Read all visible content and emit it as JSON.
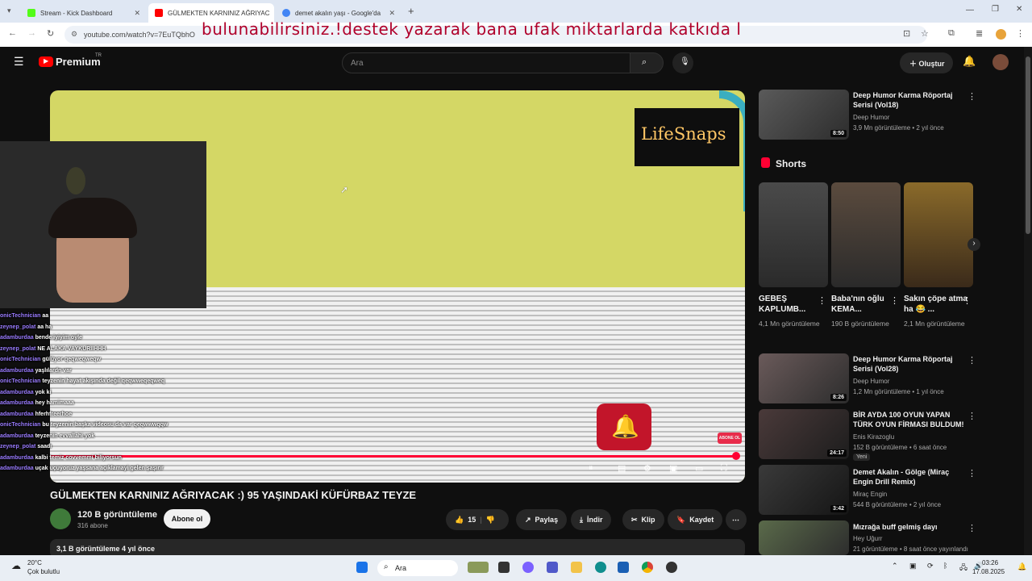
{
  "browser": {
    "tabs": [
      {
        "title": "Stream - Kick Dashboard",
        "color": "#53fc18"
      },
      {
        "title": "GÜLMEKTEN KARNINIZ AĞRIYAC",
        "color": "#ff0000"
      },
      {
        "title": "demet akalın yaşı - Google'da",
        "color": "#4285f4"
      }
    ],
    "url": "youtube.com/watch?v=7EuTQbhO",
    "overlay_caption": "bulunabilirsiniz.!destek yazarak bana ufak miktarlarda katkıda l"
  },
  "yt_header": {
    "logo": "Premium",
    "region": "TR",
    "search_placeholder": "Ara",
    "create_label": "Oluştur"
  },
  "video": {
    "overlay_logo": "LifeSnaps",
    "badge": "ABONE OL",
    "progress": 0.987,
    "title": "GÜLMEKTEN KARNINIZ AĞRIYACAK :) 95 YAŞINDAKİ KÜFÜRBAZ TEYZE",
    "channel": "120 B görüntüleme",
    "subscribers": "316 abone",
    "subscribe_label": "Abone ol",
    "likes": "15",
    "share_label": "Paylaş",
    "download_label": "İndir",
    "clip_label": "Klip",
    "save_label": "Kaydet",
    "description_meta": "3,1 B görüntüleme  4 yıl önce"
  },
  "chat": [
    {
      "user": "onicTechnician",
      "msg": "aa"
    },
    {
      "user": "zeynep_polat",
      "msg": "aa ha"
    },
    {
      "user": "adamburdaa",
      "msg": "bende iyiyim oyle"
    },
    {
      "user": "zeynep_polat",
      "msg": "NE ALAKA VAYKURIIHHH"
    },
    {
      "user": "onicTechnician",
      "msg": "gülüyor qeqweqweqw"
    },
    {
      "user": "adamburdaa",
      "msg": "yaşlılardn var"
    },
    {
      "user": "onicTechnician",
      "msg": "teyzenin hayat akışında değil qeqwweqeqweq"
    },
    {
      "user": "adamburdaa",
      "msg": "yok ki"
    },
    {
      "user": "adamburdaa",
      "msg": "hey hamimaaa"
    },
    {
      "user": "adamburdaa",
      "msg": "hferhfreerhoe"
    },
    {
      "user": "onicTechnician",
      "msg": "bu teyzenin başka videosu da var qeqwwwqqw"
    },
    {
      "user": "adamburdaa",
      "msg": "teyzenin evvallahi yok"
    },
    {
      "user": "zeynep_polat",
      "msg": "saadı"
    },
    {
      "user": "adamburdaa",
      "msg": "kalbi temiz covvemmi biliyorsun"
    },
    {
      "user": "adamburdaa",
      "msg": "uçak uçuyoruz yaşsana açıklamayi gelen şaşırır"
    }
  ],
  "sidebar": {
    "top_rec": {
      "title": "Deep Humor Karma Röportaj Serisi (Vol18)",
      "channel": "Deep Humor",
      "meta": "3,9 Mn görüntüleme • 2 yıl önce",
      "duration": "8:50"
    },
    "shorts_heading": "Shorts",
    "shorts": [
      {
        "title": "GEBEŞ KAPLUMB...",
        "views": "4,1 Mn görüntüleme"
      },
      {
        "title": "Baba'nın oğlu KEMA...",
        "views": "190 B görüntüleme"
      },
      {
        "title": "Sakın çöpe atma ha 😂 ...",
        "views": "2,1 Mn görüntüleme"
      }
    ],
    "recs": [
      {
        "title": "Deep Humor Karma Röportaj Serisi (Vol28)",
        "channel": "Deep Humor",
        "meta": "1,2 Mn görüntüleme • 1 yıl önce",
        "duration": "8:26",
        "badge": ""
      },
      {
        "title": "BİR AYDA 100 OYUN YAPAN TÜRK OYUN FİRMASI BULDUM!",
        "channel": "Enis Kirazoglu",
        "meta": "152 B görüntüleme • 6 saat önce",
        "duration": "24:17",
        "badge": "Yeni"
      },
      {
        "title": "Demet Akalın - Gölge (Miraç Engin Drill Remix)",
        "channel": "Miraç Engin",
        "meta": "544 B görüntüleme • 2 yıl önce",
        "duration": "3:42",
        "badge": ""
      },
      {
        "title": "Mızrağa buff gelmiş dayı",
        "channel": "Hey Uğurr",
        "meta": "21 görüntüleme • 8 saat önce yayınlandı",
        "duration": "",
        "badge": ""
      }
    ]
  },
  "taskbar": {
    "weather_temp": "20°C",
    "weather_desc": "Çok bulutlu",
    "search_label": "Ara",
    "time": "03:26",
    "date": "17.08.2025"
  }
}
